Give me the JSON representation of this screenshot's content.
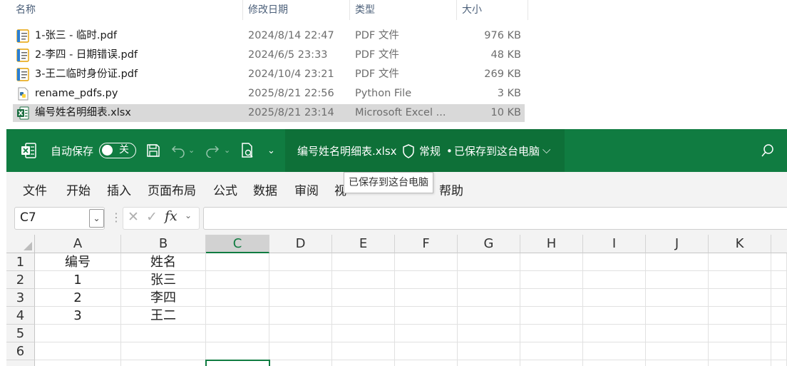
{
  "explorer": {
    "headers": {
      "name": "名称",
      "modified": "修改日期",
      "type": "类型",
      "size": "大小"
    },
    "files": [
      {
        "name": "1-张三 - 临时.pdf",
        "date": "2024/8/14 22:47",
        "type": "PDF 文件",
        "size": "976 KB",
        "icon": "pdf-file-icon"
      },
      {
        "name": "2-李四 - 日期错误.pdf",
        "date": "2024/6/5 23:33",
        "type": "PDF 文件",
        "size": "48 KB",
        "icon": "pdf-file-icon"
      },
      {
        "name": "3-王二临时身份证.pdf",
        "date": "2024/10/4 23:21",
        "type": "PDF 文件",
        "size": "269 KB",
        "icon": "pdf-file-icon"
      },
      {
        "name": "rename_pdfs.py",
        "date": "2025/8/21 22:56",
        "type": "Python File",
        "size": "3 KB",
        "icon": "python-file-icon"
      },
      {
        "name": "编号姓名明细表.xlsx",
        "date": "2025/8/21 23:14",
        "type": "Microsoft Excel ...",
        "size": "10 KB",
        "icon": "excel-file-icon"
      }
    ]
  },
  "excel": {
    "autosave_label": "自动保存",
    "autosave_state": "关",
    "filename": "编号姓名明细表.xlsx",
    "sensitivity": "常规",
    "save_status": "已保存到这台电脑",
    "tooltip": "已保存到这台电脑",
    "tabs": [
      "文件",
      "开始",
      "插入",
      "页面布局",
      "公式",
      "数据",
      "审阅",
      "视",
      "帮助"
    ],
    "name_box": "C7",
    "fx_label": "fx",
    "columns": [
      "A",
      "B",
      "C",
      "D",
      "E",
      "F",
      "G",
      "H",
      "I",
      "J",
      "K"
    ],
    "active_column": "C",
    "rows": [
      "1",
      "2",
      "3",
      "4",
      "5",
      "6"
    ],
    "cells": [
      [
        "编号",
        "姓名"
      ],
      [
        "1",
        "张三"
      ],
      [
        "2",
        "李四"
      ],
      [
        "3",
        "王二"
      ],
      [
        "",
        ""
      ],
      [
        "",
        ""
      ]
    ],
    "colors": {
      "brand": "#107c41",
      "ribbon": "#f3f3f3"
    }
  }
}
